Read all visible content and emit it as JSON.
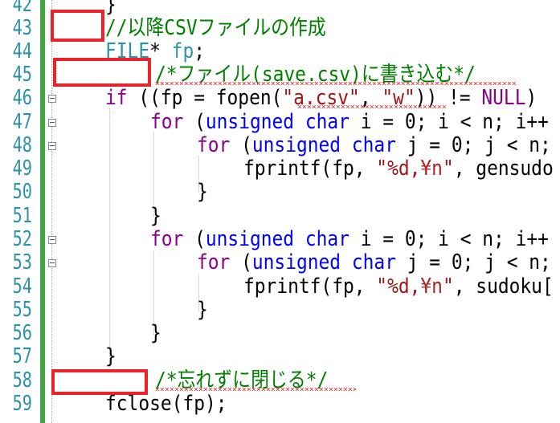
{
  "editor": {
    "line_numbers": [
      "42",
      "43",
      "44",
      "45",
      "46",
      "47",
      "48",
      "49",
      "50",
      "51",
      "52",
      "53",
      "54",
      "55",
      "56",
      "57",
      "58",
      "59"
    ],
    "lines": {
      "l42": {
        "brace": "}"
      },
      "l43": {
        "comment": "//以降CSVファイルの作成"
      },
      "l44": {
        "type": "FILE",
        "rest": "* ",
        "var": "fp",
        "end": ";"
      },
      "l45": {
        "comment": "/*ファイル(save.csv)に書き込む*/"
      },
      "l46": {
        "kw": "if",
        "a": " ((fp = fopen(",
        "s1": "\"a.csv\"",
        "b": ", ",
        "s2": "\"w\"",
        "c": ")) != ",
        "null": "NULL",
        "d": ")"
      },
      "l47": {
        "kw": "for",
        "a": " (",
        "t1": "unsigned",
        "sp": " ",
        "t2": "char",
        "b": " i = 0; i < n; i++"
      },
      "l48": {
        "kw": "for",
        "a": " (",
        "t1": "unsigned",
        "sp": " ",
        "t2": "char",
        "b": " j = 0; j < n;"
      },
      "l49": {
        "a": "fprintf(fp, ",
        "s1": "\"%d,",
        "esc": "¥n",
        "s2": "\"",
        "b": ", gensudo"
      },
      "l50": {
        "brace": "}"
      },
      "l51": {
        "brace": "}"
      },
      "l52": {
        "kw": "for",
        "a": " (",
        "t1": "unsigned",
        "sp": " ",
        "t2": "char",
        "b": " i = 0; i < n; i++"
      },
      "l53": {
        "kw": "for",
        "a": " (",
        "t1": "unsigned",
        "sp": " ",
        "t2": "char",
        "b": " j = 0; j < n;"
      },
      "l54": {
        "a": "fprintf(fp, ",
        "s1": "\"%d,",
        "esc": "¥n",
        "s2": "\"",
        "b": ", sudoku["
      },
      "l55": {
        "brace": "}"
      },
      "l56": {
        "brace": "}"
      },
      "l57": {
        "brace": "}"
      },
      "l58": {
        "comment": "/*忘れずに閉じる*/"
      },
      "l59": {
        "code": "fclose(fp);"
      }
    }
  },
  "colors": {
    "keyword": "#0000ff",
    "control": "#8b008b",
    "comment": "#008000",
    "string": "#a31515",
    "line_number": "#2b91af",
    "highlight_box": "#e8242a",
    "change_bar": "#41a441"
  }
}
